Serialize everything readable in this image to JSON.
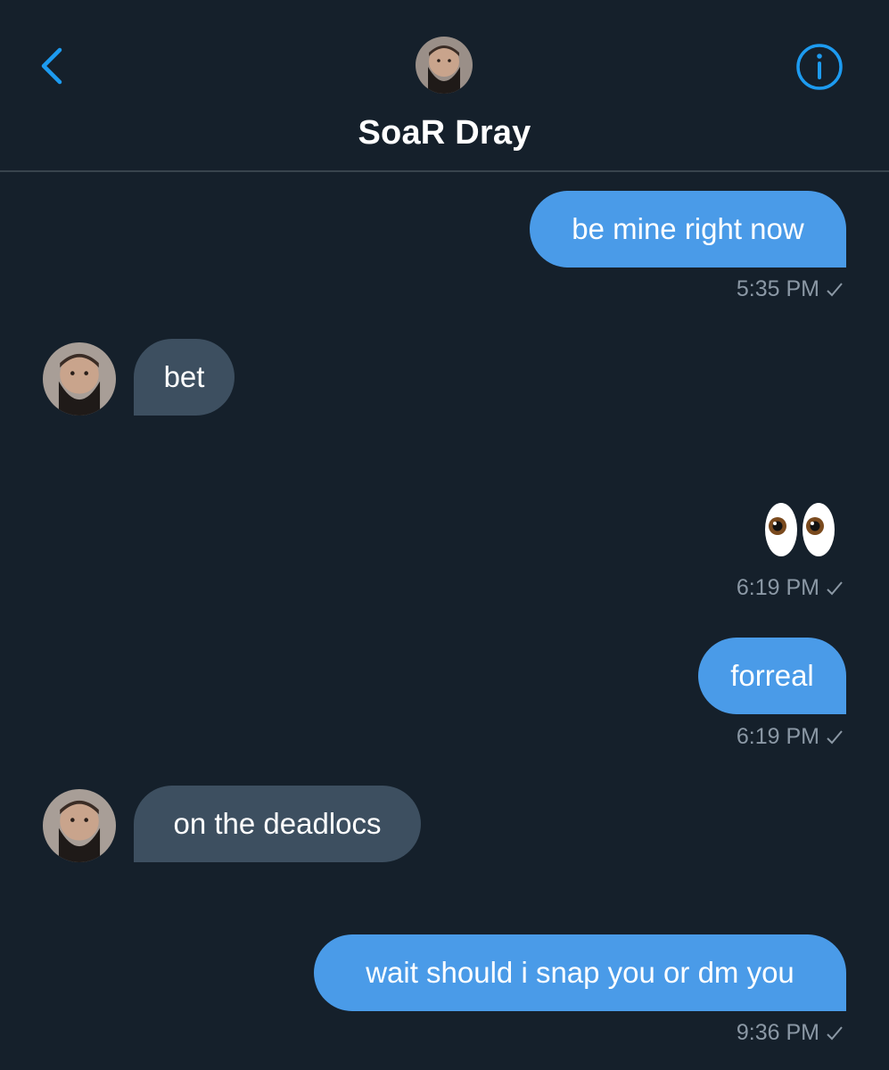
{
  "header": {
    "contact_name": "SoaR Dray",
    "back_icon": "chevron-left-icon",
    "info_icon": "info-circle-icon"
  },
  "messages": [
    {
      "direction": "outgoing",
      "text": "be mine right now",
      "time": "5:35 PM"
    },
    {
      "direction": "incoming",
      "text": "bet"
    },
    {
      "direction": "outgoing",
      "text": "👀",
      "time": "6:19 PM"
    },
    {
      "direction": "outgoing",
      "text": "forreal",
      "time": "6:19 PM"
    },
    {
      "direction": "incoming",
      "text": "on the deadlocs"
    },
    {
      "direction": "outgoing",
      "text": "wait should i snap you or dm you",
      "time": "9:36 PM"
    }
  ],
  "colors": {
    "background": "#15202b",
    "outgoing_bubble": "#4a9be8",
    "incoming_bubble": "#3d4f60",
    "accent": "#1d9bf0",
    "meta_text": "#8b98a5"
  }
}
